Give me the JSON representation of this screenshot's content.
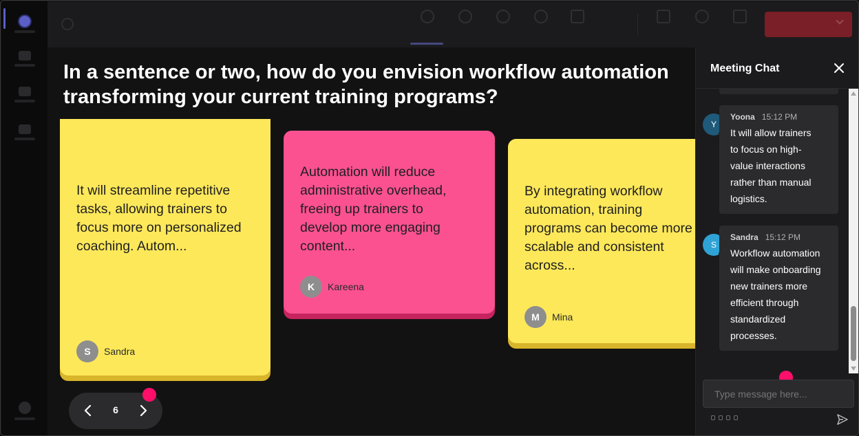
{
  "question": {
    "line1": "In a sentence or two, how do you envision workflow automation",
    "line2": "transforming your current training programs?"
  },
  "notes": [
    {
      "color": "yellow",
      "lines": [
        "It will streamline repetitive",
        "tasks, allowing trainers to",
        "focus more on personalized",
        "coaching. Autom..."
      ],
      "author_initial": "S",
      "author": "Sandra"
    },
    {
      "color": "pink",
      "lines": [
        "Automation will reduce",
        "administrative overhead,",
        "freeing up trainers to",
        "develop more engaging",
        "content..."
      ],
      "author_initial": "K",
      "author": "Kareena"
    },
    {
      "color": "yellow",
      "lines": [
        "By integrating workflow",
        "automation, training",
        "programs can become more",
        "scalable and consistent",
        "across..."
      ],
      "author_initial": "M",
      "author": "Mina"
    }
  ],
  "pager": {
    "page": "6"
  },
  "chat": {
    "title": "Meeting Chat",
    "messages": [
      {
        "initial": "Y",
        "name": "Yoona",
        "time": "15:12 PM",
        "lines": [
          "It will allow trainers",
          "to focus on high-",
          "value interactions",
          "rather than manual",
          "logistics."
        ],
        "avatar_color": "#1f5a7a"
      },
      {
        "initial": "S",
        "name": "Sandra",
        "time": "15:12 PM",
        "lines": [
          "Workflow automation",
          "will make onboarding",
          "new trainers more",
          "efficient through",
          "standardized",
          "processes."
        ],
        "avatar_color": "#2fa3d6"
      }
    ],
    "input_placeholder": "Type message here..."
  },
  "colors": {
    "note_yellow": "#fde85a",
    "note_pink": "#fb5191",
    "accent": "#ff0f6a"
  }
}
